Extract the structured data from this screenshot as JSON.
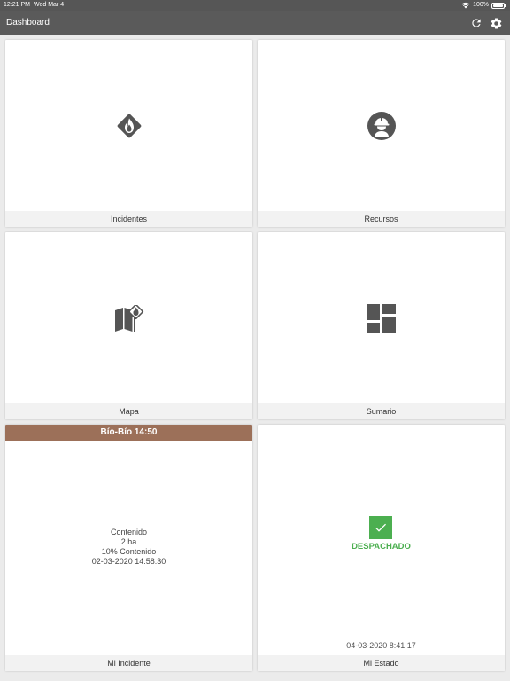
{
  "statusbar": {
    "time": "12:21 PM",
    "date": "Wed Mar 4",
    "battery": "100%"
  },
  "navbar": {
    "title": "Dashboard",
    "refresh_icon": "refresh-icon",
    "settings_icon": "gear-icon"
  },
  "tiles": {
    "incidentes": {
      "label": "Incidentes",
      "icon": "fire-diamond-icon"
    },
    "recursos": {
      "label": "Recursos",
      "icon": "firefighter-icon"
    },
    "mapa": {
      "label": "Mapa",
      "icon": "map-fire-icon"
    },
    "sumario": {
      "label": "Sumario",
      "icon": "dashboard-grid-icon"
    }
  },
  "mi_incidente": {
    "header": "Bío-Bío 14:50",
    "status": "Contenido",
    "area": "2 ha",
    "containment": "10% Contenido",
    "timestamp": "02-03-2020 14:58:30",
    "label": "Mi Incidente"
  },
  "mi_estado": {
    "status": "DESPACHADO",
    "timestamp": "04-03-2020 8:41:17",
    "label": "Mi Estado",
    "icon": "check-icon"
  },
  "colors": {
    "navbar": "#5a5a5a",
    "accent_green": "#4caf50",
    "incident_brown": "#9c7059",
    "icon_gray": "#555555"
  }
}
